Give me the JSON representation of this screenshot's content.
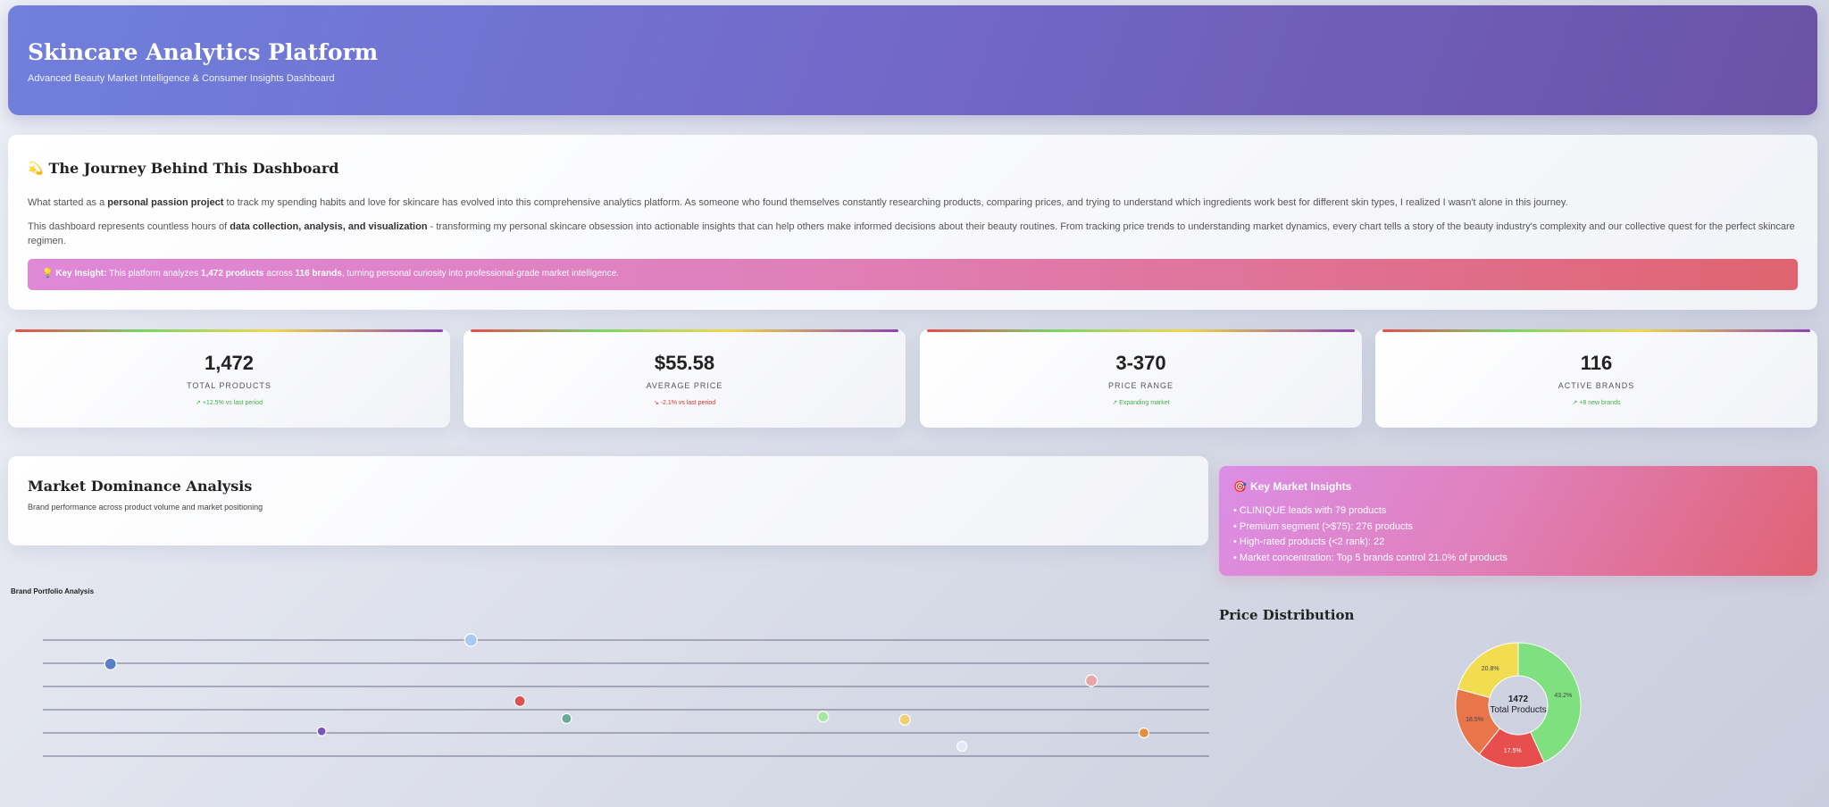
{
  "header": {
    "title": "Skincare Analytics Platform",
    "subtitle": "Advanced Beauty Market Intelligence & Consumer Insights Dashboard"
  },
  "journey": {
    "icon": "dizzy-star-icon",
    "title": "The Journey Behind This Dashboard",
    "p1_pre": "What started as a ",
    "p1_bold": "personal passion project",
    "p1_post": " to track my spending habits and love for skincare has evolved into this comprehensive analytics platform. As someone who found themselves constantly researching products, comparing prices, and trying to understand which ingredients work best for different skin types, I realized I wasn't alone in this journey.",
    "p2_pre": "This dashboard represents countless hours of ",
    "p2_bold": "data collection, analysis, and visualization",
    "p2_post": " - transforming my personal skincare obsession into actionable insights that can help others make informed decisions about their beauty routines. From tracking price trends to understanding market dynamics, every chart tells a story of the beauty industry's complexity and our collective quest for the perfect skincare regimen.",
    "insight_icon": "lightbulb-icon",
    "insight_label": "Key Insight:",
    "insight_pre": " This platform analyzes ",
    "insight_products": "1,472 products",
    "insight_mid": " across ",
    "insight_brands": "116 brands",
    "insight_post": ", turning personal curiosity into professional-grade market intelligence."
  },
  "stats": [
    {
      "value": "1,472",
      "label": "TOTAL PRODUCTS",
      "change": "↗ +12.5% vs last period",
      "trend": "up"
    },
    {
      "value": "$55.58",
      "label": "AVERAGE PRICE",
      "change": "↘ -2.1% vs last period",
      "trend": "down"
    },
    {
      "value": "3-370",
      "label": "PRICE RANGE",
      "change": "↗ Expanding market",
      "trend": "up"
    },
    {
      "value": "116",
      "label": "ACTIVE BRANDS",
      "change": "↗ +8 new brands",
      "trend": "up"
    }
  ],
  "market": {
    "title": "Market Dominance Analysis",
    "subtitle": "Brand performance across product volume and market positioning"
  },
  "key_insights": {
    "icon": "target-icon",
    "title": "Key Market Insights",
    "items": [
      "• CLINIQUE leads with 79 products",
      "• Premium segment (>$75): 276 products",
      "• High-rated products (<2 rank): 22",
      "• Market concentration: Top 5 brands control 21.0% of products"
    ]
  },
  "brand_portfolio": {
    "title": "Brand Portfolio Analysis"
  },
  "price_distribution": {
    "title": "Price Distribution",
    "center_value": "1472",
    "center_label": "Total Products"
  },
  "chart_data": [
    {
      "type": "scatter",
      "title": "Brand Portfolio Analysis",
      "x_range": [
        0,
        100
      ],
      "y_range": [
        0,
        5
      ],
      "grid": true,
      "points": [
        {
          "x": 36.7,
          "y": 5.0,
          "color": "#a9c9f2",
          "size": 7
        },
        {
          "x": 5.8,
          "y": 3.97,
          "color": "#5b7ec9",
          "size": 6.5
        },
        {
          "x": 40.9,
          "y": 2.37,
          "color": "#d9534f",
          "size": 6
        },
        {
          "x": 44.9,
          "y": 1.62,
          "color": "#6aaa96",
          "size": 5.5
        },
        {
          "x": 66.9,
          "y": 1.7,
          "color": "#a6e8a0",
          "size": 6
        },
        {
          "x": 73.9,
          "y": 1.57,
          "color": "#f0cd70",
          "size": 6
        },
        {
          "x": 89.9,
          "y": 3.25,
          "color": "#e8a6a6",
          "size": 6.5
        },
        {
          "x": 94.4,
          "y": 1.0,
          "color": "#e09040",
          "size": 5.5
        },
        {
          "x": 23.9,
          "y": 1.07,
          "color": "#7b55b8",
          "size": 5
        },
        {
          "x": 78.8,
          "y": 0.42,
          "color": "#e4e8f6",
          "size": 5.5
        }
      ]
    },
    {
      "type": "pie",
      "title": "Price Distribution",
      "values": [
        43.2,
        17.5,
        18.5,
        20.8
      ],
      "labels": [
        "43.2%",
        "17.5%",
        "18.5%",
        "20.8%"
      ],
      "colors": [
        "#7ee07e",
        "#e84e4e",
        "#e8764a",
        "#f2dc50"
      ]
    }
  ]
}
